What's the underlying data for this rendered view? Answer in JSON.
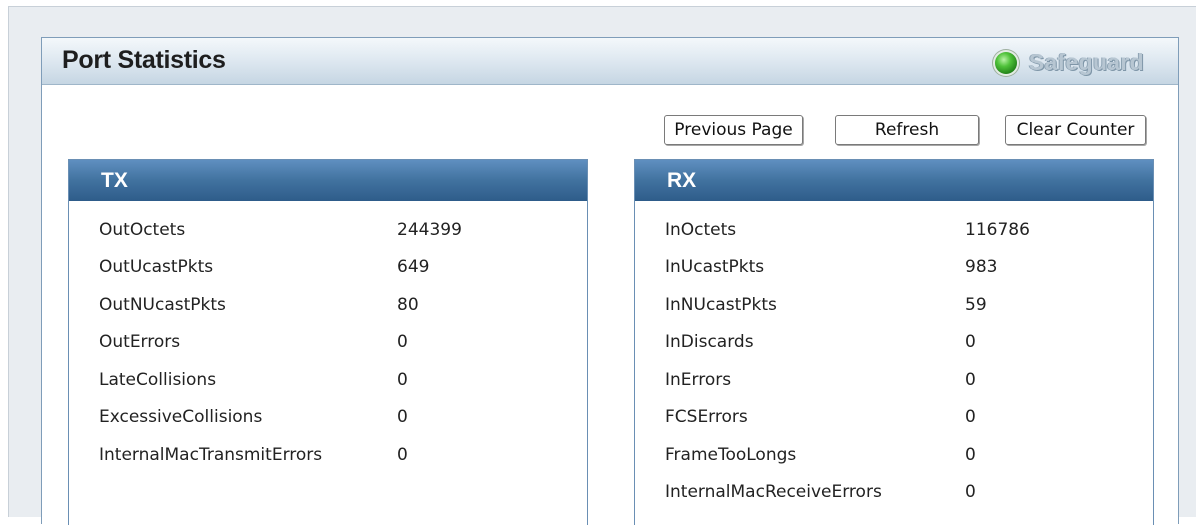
{
  "page": {
    "title": "Port Statistics",
    "safeguard_label": "Safeguard",
    "safeguard_status_color": "#3cb52a"
  },
  "toolbar": {
    "previous_page_label": "Previous Page",
    "refresh_label": "Refresh",
    "clear_counter_label": "Clear Counter"
  },
  "tx": {
    "heading": "TX",
    "rows": [
      {
        "name": "OutOctets",
        "value": "244399"
      },
      {
        "name": "OutUcastPkts",
        "value": "649"
      },
      {
        "name": "OutNUcastPkts",
        "value": "80"
      },
      {
        "name": "OutErrors",
        "value": "0"
      },
      {
        "name": "LateCollisions",
        "value": "0"
      },
      {
        "name": "ExcessiveCollisions",
        "value": "0"
      },
      {
        "name": "InternalMacTransmitErrors",
        "value": "0"
      }
    ]
  },
  "rx": {
    "heading": "RX",
    "rows": [
      {
        "name": "InOctets",
        "value": "116786"
      },
      {
        "name": "InUcastPkts",
        "value": "983"
      },
      {
        "name": "InNUcastPkts",
        "value": "59"
      },
      {
        "name": "InDiscards",
        "value": "0"
      },
      {
        "name": "InErrors",
        "value": "0"
      },
      {
        "name": "FCSErrors",
        "value": "0"
      },
      {
        "name": "FrameTooLongs",
        "value": "0"
      },
      {
        "name": "InternalMacReceiveErrors",
        "value": "0"
      }
    ]
  },
  "colors": {
    "section_header": "#41729f",
    "panel_border": "#7f9db9"
  }
}
